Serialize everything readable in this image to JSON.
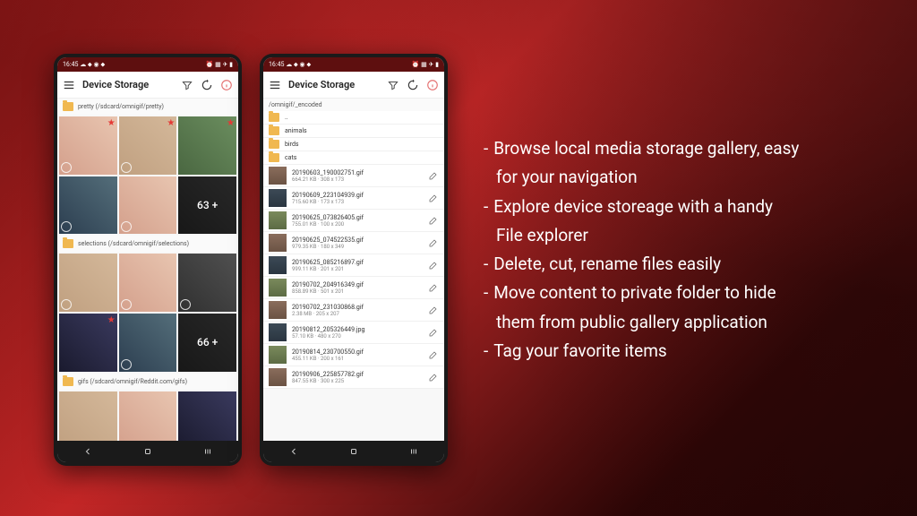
{
  "statusbar": {
    "time": "16:45",
    "icons_left": "☁ ⬥ ◉ ⬥",
    "icons_right": "⏰ ▦ ✈ ▮"
  },
  "appbar": {
    "title": "Device Storage"
  },
  "phone1": {
    "sections": [
      {
        "label": "pretty (/sdcard/omnigif/pretty)",
        "more": "63 +"
      },
      {
        "label": "selections (/sdcard/omnigif/selections)",
        "more": "66 +"
      },
      {
        "label": "gifs (/sdcard/omnigif/Reddit.com/gifs)"
      }
    ]
  },
  "phone2": {
    "path": "/omnigif/_encoded",
    "folders": [
      "..",
      "animals",
      "birds",
      "cats"
    ],
    "files": [
      {
        "name": "20190603_190002751.gif",
        "meta": "664.21 KB · 308 x 173"
      },
      {
        "name": "20190609_223104939.gif",
        "meta": "715.60 KB · 173 x 173"
      },
      {
        "name": "20190625_073826405.gif",
        "meta": "755.01 KB · 100 x 200"
      },
      {
        "name": "20190625_074522535.gif",
        "meta": "979.35 KB · 180 x 349"
      },
      {
        "name": "20190625_085216897.gif",
        "meta": "999.11 KB · 201 x 201"
      },
      {
        "name": "20190702_204916349.gif",
        "meta": "858.89 KB · 501 x 201"
      },
      {
        "name": "20190702_231030868.gif",
        "meta": "2.38 MB · 205 x 207"
      },
      {
        "name": "20190812_205326449.jpg",
        "meta": "57.10 KB · 480 x 270"
      },
      {
        "name": "20190814_230700550.gif",
        "meta": "455.11 KB · 200 x 161"
      },
      {
        "name": "20190906_225857782.gif",
        "meta": "847.55 KB · 300 x 225"
      }
    ]
  },
  "features": [
    "Browse local media storage gallery, easy",
    "  for your navigation",
    "Explore device storeage with a handy",
    "  File explorer",
    "Delete, cut, rename files easily",
    "Move content to private folder to hide",
    "  them from public gallery application",
    "Tag your favorite items"
  ]
}
